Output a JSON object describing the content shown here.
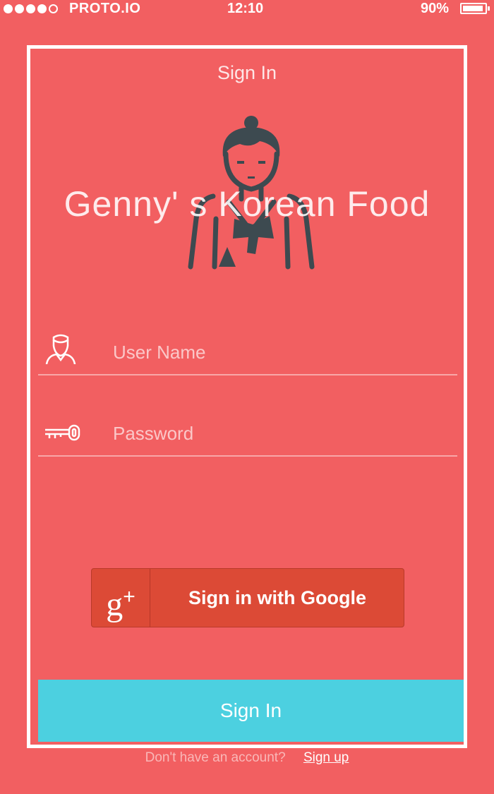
{
  "status_bar": {
    "carrier": "PROTO.IO",
    "time": "12:10",
    "battery_percent": "90%",
    "battery_level": 0.9,
    "signal_bars": 4,
    "signal_bars_total": 5
  },
  "screen": {
    "title": "Sign In"
  },
  "brand": {
    "title": "Genny' s Korean Food",
    "mascot_icon": "korean-hanbok-person-icon"
  },
  "form": {
    "username": {
      "placeholder": "User Name",
      "value": "",
      "icon": "user-icon"
    },
    "password": {
      "placeholder": "Password",
      "value": "",
      "icon": "key-icon"
    }
  },
  "google_button": {
    "badge": "g",
    "badge_plus": "+",
    "label": "Sign in with Google",
    "color": "#dc4a36"
  },
  "signin_button": {
    "label": "Sign In",
    "color": "#4cd0e0"
  },
  "footer": {
    "prompt": "Don't have an account?",
    "signup_label": "Sign up"
  },
  "colors": {
    "background": "#f25f61",
    "illustration": "#3d4a50"
  }
}
